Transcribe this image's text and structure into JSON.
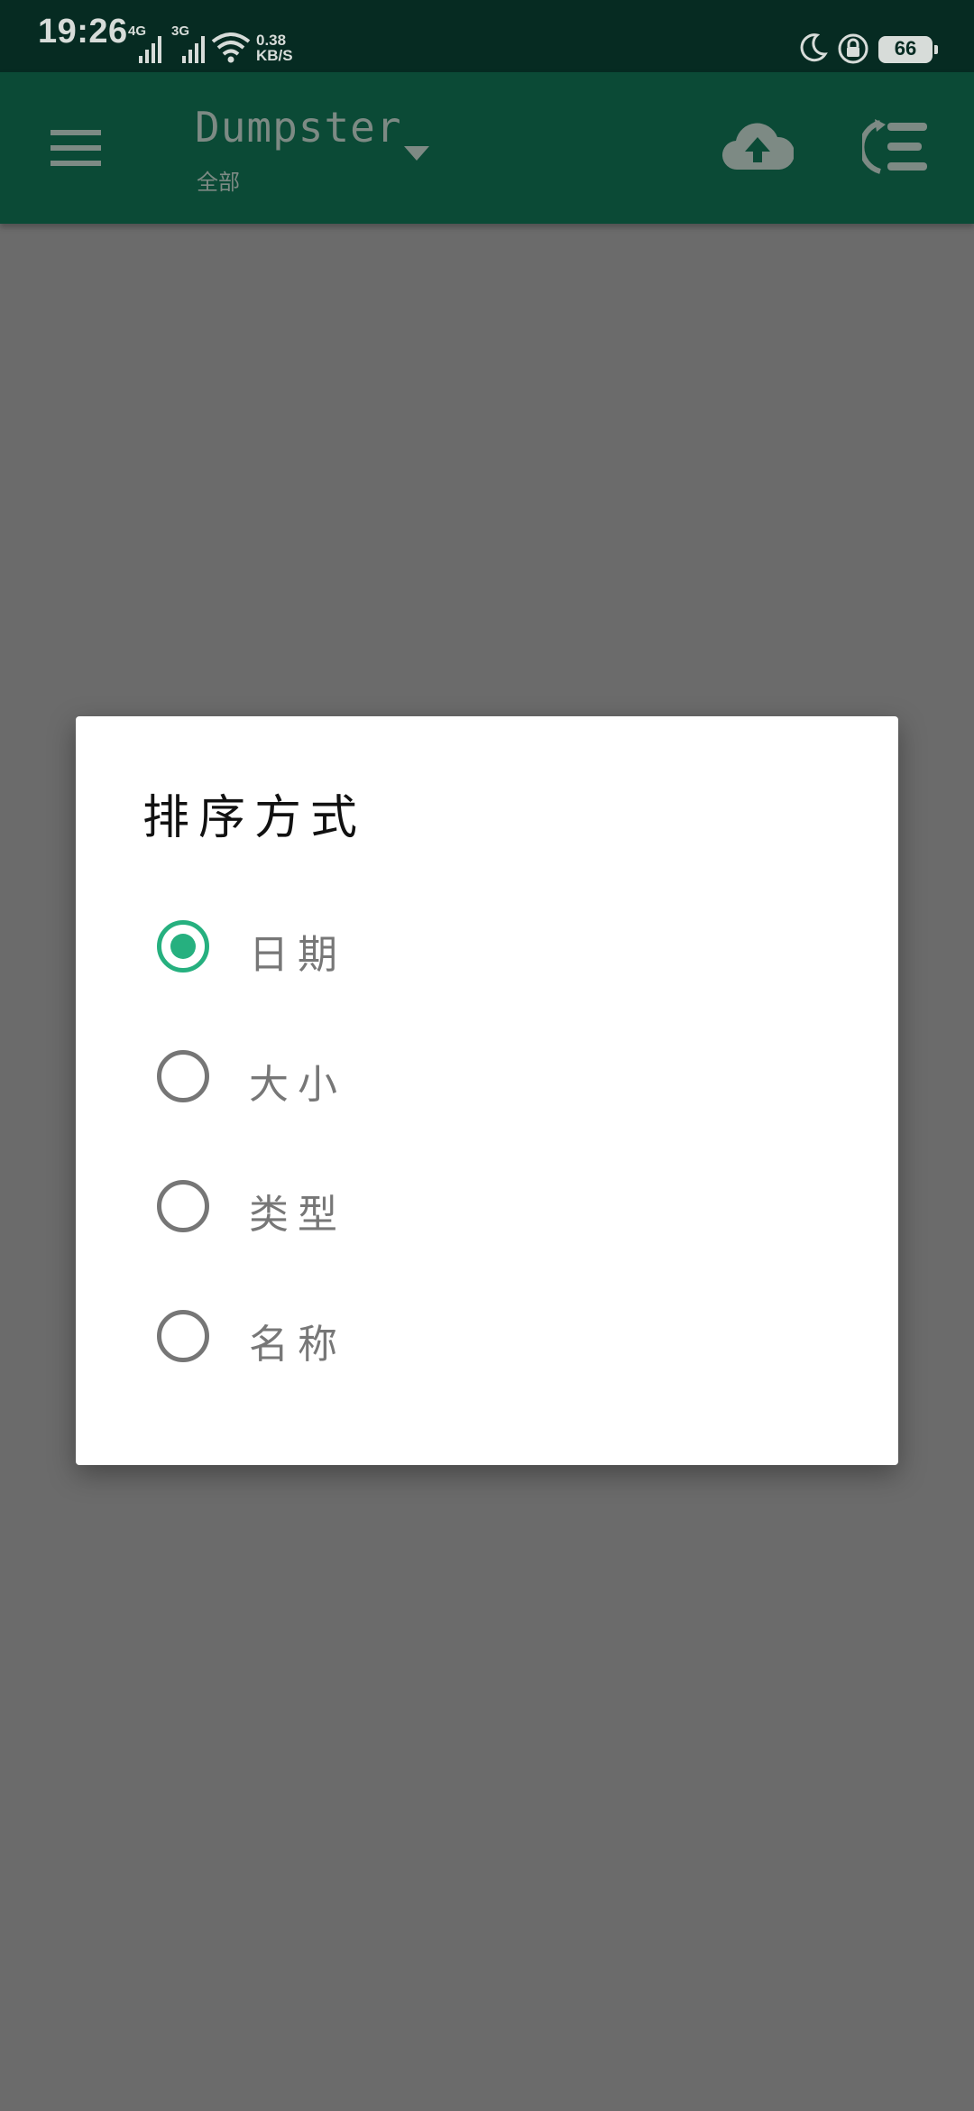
{
  "status_bar": {
    "time": "19:26",
    "signal_1_network": "4G",
    "signal_2_network": "3G",
    "net_speed_value": "0.38",
    "net_speed_unit": "KB/S",
    "battery_level": "66"
  },
  "app_bar": {
    "title": "Dumpster",
    "subtitle": "全部"
  },
  "dialog": {
    "title": "排序方式",
    "options": [
      {
        "label": "日期",
        "checked": true
      },
      {
        "label": "大小",
        "checked": false
      },
      {
        "label": "类型",
        "checked": false
      },
      {
        "label": "名称",
        "checked": false
      }
    ]
  },
  "colors": {
    "status_bar_bg": "#062b22",
    "app_bar_bg": "#0b4a36",
    "accent": "#26b07f",
    "scrim": "#6b6b6b"
  }
}
